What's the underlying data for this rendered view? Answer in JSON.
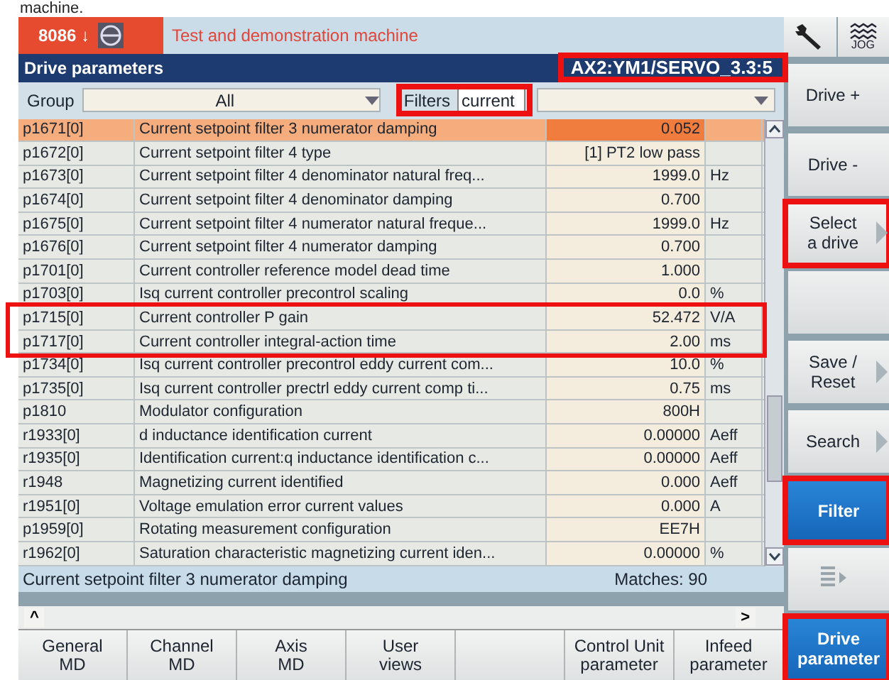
{
  "caption": "machine.",
  "header": {
    "channel": "8086 ↓",
    "message": "Test and demonstration machine"
  },
  "title_bar": {
    "title": "Drive parameters",
    "drive": "AX2:YM1/SERVO_3.3:5",
    "drive_annotated": true
  },
  "filter_row": {
    "group_label": "Group",
    "group_value": "All",
    "filters_label": "Filters",
    "filters_value": "current",
    "filters_annotated": true
  },
  "table": {
    "rows": [
      {
        "param": "p1671[0]",
        "description": "Current setpoint filter 3 numerator damping",
        "value": "0.052",
        "unit": "",
        "selected": true,
        "annotated": false
      },
      {
        "param": "p1672[0]",
        "description": "Current setpoint filter 4 type",
        "value": "[1] PT2 low pass",
        "unit": "",
        "selected": false,
        "annotated": false
      },
      {
        "param": "p1673[0]",
        "description": "Current setpoint filter 4 denominator natural freq...",
        "value": "1999.0",
        "unit": "Hz",
        "selected": false,
        "annotated": false
      },
      {
        "param": "p1674[0]",
        "description": "Current setpoint filter 4 denominator damping",
        "value": "0.700",
        "unit": "",
        "selected": false,
        "annotated": false
      },
      {
        "param": "p1675[0]",
        "description": "Current setpoint filter 4 numerator natural freque...",
        "value": "1999.0",
        "unit": "Hz",
        "selected": false,
        "annotated": false
      },
      {
        "param": "p1676[0]",
        "description": "Current setpoint filter 4 numerator damping",
        "value": "0.700",
        "unit": "",
        "selected": false,
        "annotated": false
      },
      {
        "param": "p1701[0]",
        "description": "Current controller reference model dead time",
        "value": "1.000",
        "unit": "",
        "selected": false,
        "annotated": false
      },
      {
        "param": "p1703[0]",
        "description": "Isq current controller precontrol scaling",
        "value": "0.0",
        "unit": "%",
        "selected": false,
        "annotated": false
      },
      {
        "param": "p1715[0]",
        "description": "Current controller P gain",
        "value": "52.472",
        "unit": "V/A",
        "selected": false,
        "annotated": true
      },
      {
        "param": "p1717[0]",
        "description": "Current controller integral-action time",
        "value": "2.00",
        "unit": "ms",
        "selected": false,
        "annotated": true
      },
      {
        "param": "p1734[0]",
        "description": "Isq current controller precontrol eddy current com...",
        "value": "10.0",
        "unit": "%",
        "selected": false,
        "annotated": false
      },
      {
        "param": "p1735[0]",
        "description": "Isq current controller prectrl eddy current comp ti...",
        "value": "0.75",
        "unit": "ms",
        "selected": false,
        "annotated": false
      },
      {
        "param": "p1810",
        "description": "Modulator configuration",
        "value": "800H",
        "unit": "",
        "selected": false,
        "annotated": false
      },
      {
        "param": "r1933[0]",
        "description": "d inductance identification current",
        "value": "0.00000",
        "unit": "Aeff",
        "selected": false,
        "annotated": false
      },
      {
        "param": "r1935[0]",
        "description": "Identification current:q inductance identification c...",
        "value": "0.00000",
        "unit": "Aeff",
        "selected": false,
        "annotated": false
      },
      {
        "param": "r1948",
        "description": "Magnetizing current identified",
        "value": "0.000",
        "unit": "Aeff",
        "selected": false,
        "annotated": false
      },
      {
        "param": "r1951[0]",
        "description": "Voltage emulation error current values",
        "value": "0.000",
        "unit": "A",
        "selected": false,
        "annotated": false
      },
      {
        "param": "p1959[0]",
        "description": "Rotating measurement configuration",
        "value": "EE7H",
        "unit": "",
        "selected": false,
        "annotated": false
      },
      {
        "param": "r1962[0]",
        "description": "Saturation characteristic magnetizing current iden...",
        "value": "0.00000",
        "unit": "%",
        "selected": false,
        "annotated": false
      }
    ]
  },
  "status_bar": {
    "description": "Current setpoint filter 3 numerator damping",
    "matches": "Matches: 90"
  },
  "scroll_row": {
    "left": "^",
    "right": ">"
  },
  "side_top": {
    "jog": "JOG"
  },
  "side_softkeys": [
    {
      "kind": "key",
      "lines": [
        "Drive +"
      ],
      "arrow": false,
      "selected": false,
      "annotated": false
    },
    {
      "kind": "key",
      "lines": [
        "Drive -"
      ],
      "arrow": false,
      "selected": false,
      "annotated": false
    },
    {
      "kind": "key",
      "lines": [
        "Select",
        "a drive"
      ],
      "arrow": true,
      "selected": false,
      "annotated": true
    },
    {
      "kind": "empty"
    },
    {
      "kind": "key",
      "lines": [
        "Save /",
        "Reset"
      ],
      "arrow": true,
      "selected": false,
      "annotated": false
    },
    {
      "kind": "key",
      "lines": [
        "Search"
      ],
      "arrow": true,
      "selected": false,
      "annotated": false
    },
    {
      "kind": "key",
      "lines": [
        "Filter"
      ],
      "arrow": false,
      "selected": true,
      "annotated": true
    },
    {
      "kind": "more"
    },
    {
      "kind": "key",
      "lines": [
        "Drive",
        "parameter"
      ],
      "arrow": false,
      "selected": true,
      "annotated": true
    }
  ],
  "bottom_softkeys": [
    {
      "kind": "key",
      "lines": [
        "General",
        "MD"
      ]
    },
    {
      "kind": "key",
      "lines": [
        "Channel",
        "MD"
      ]
    },
    {
      "kind": "key",
      "lines": [
        "Axis",
        "MD"
      ]
    },
    {
      "kind": "key",
      "lines": [
        "User",
        "views"
      ]
    },
    {
      "kind": "empty"
    },
    {
      "kind": "key",
      "lines": [
        "Control Unit",
        "parameter"
      ]
    },
    {
      "kind": "key",
      "lines": [
        "Infeed",
        "parameter"
      ]
    }
  ]
}
